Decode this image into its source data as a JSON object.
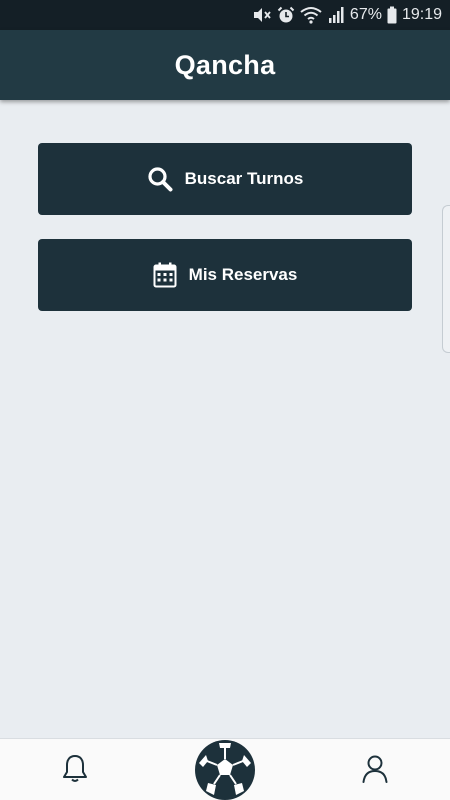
{
  "status_bar": {
    "battery": "67%",
    "time": "19:19",
    "icons": [
      "mute-icon",
      "alarm-icon",
      "wifi-icon",
      "signal-icon",
      "battery-icon"
    ]
  },
  "app_bar": {
    "title": "Qancha"
  },
  "menu": {
    "search": {
      "label": "Buscar Turnos",
      "icon": "search-icon"
    },
    "reservations": {
      "label": "Mis Reservas",
      "icon": "calendar-icon"
    }
  },
  "bottom_nav": {
    "items": [
      {
        "icon": "bell-icon"
      },
      {
        "icon": "soccer-ball-icon"
      },
      {
        "icon": "user-icon"
      }
    ]
  },
  "colors": {
    "app_bar": "#223a44",
    "button": "#1d313b",
    "background": "#e9edf1"
  }
}
